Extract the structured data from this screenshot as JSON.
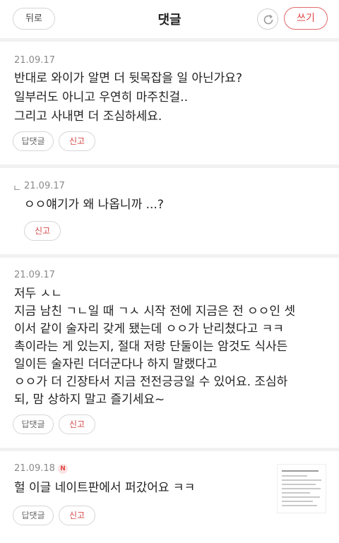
{
  "header": {
    "back_label": "뒤로",
    "title": "댓글",
    "write_label": "쓰기"
  },
  "comments": [
    {
      "date": "21.09.17",
      "lines": [
        "반대로 와이가 알면 더 뒷목잡을 일 아닌가요?",
        "일부러도 아니고 우연히 마주친걸..",
        "그리고 사내면 더 조심하세요."
      ],
      "reply_label": "답댓글",
      "report_label": "신고"
    },
    {
      "reply_mark": "ㄴ",
      "date": "21.09.17",
      "lines": [
        "ㅇㅇ얘기가 왜 나옵니까 ...?"
      ],
      "report_label": "신고"
    },
    {
      "date": "21.09.17",
      "lines": [
        "저두 ㅅㄴ",
        "지금 남친 ㄱㄴ일 때 ㄱㅅ 시작 전에 지금은 전 ㅇㅇ인 셋",
        "이서 같이 술자리 갖게 됐는데 ㅇㅇ가 난리쳤다고 ㅋㅋ",
        "촉이라는 게 있는지, 절대 저랑 단둘이는 암것도 식사든",
        "일이든 술자린 더더군다나 하지 말랬다고",
        "ㅇㅇ가 더 긴장타서 지금 전전긍긍일 수 있어요. 조심하",
        "되, 맘 상하지 말고 즐기세요~"
      ],
      "reply_label": "답댓글",
      "report_label": "신고"
    },
    {
      "date": "21.09.18",
      "badge": "N",
      "lines": [
        "헐 이글 네이트판에서 퍼갔어요 ㅋㅋ"
      ],
      "reply_label": "답댓글",
      "report_label": "신고"
    }
  ],
  "icons": {
    "refresh": "refresh-icon",
    "new_badge": "new-badge-icon",
    "thumbnail": "attached-screenshot-thumbnail"
  },
  "colors": {
    "accent": "#e04848",
    "muted": "#8a8a8a",
    "separator": "#f1f1f1"
  }
}
